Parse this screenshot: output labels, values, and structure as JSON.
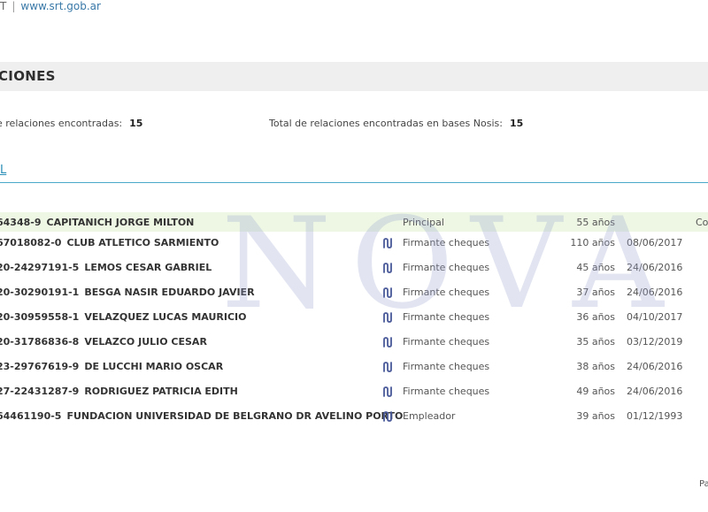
{
  "topbar": {
    "left_fragment": "T",
    "separator": "|",
    "link": "www.srt.gob.ar"
  },
  "section": {
    "title": "CIONES"
  },
  "summary": {
    "left_label": "e relaciones encontradas:",
    "left_value": "15",
    "right_label": "Total de relaciones encontradas en bases Nosis:",
    "right_value": "15"
  },
  "tab": {
    "label": "L"
  },
  "watermark": "NOVA",
  "rows": [
    {
      "id": "64348-9",
      "name": "CAPITANICH JORGE MILTON",
      "relation": "Principal",
      "age": "55 años",
      "date": "",
      "extra": "Co",
      "has_icon": false
    },
    {
      "id": "67018082-0",
      "name": "CLUB ATLETICO SARMIENTO",
      "relation": "Firmante cheques",
      "age": "110 años",
      "date": "08/06/2017",
      "extra": "",
      "has_icon": true
    },
    {
      "id": "20-24297191-5",
      "name": "LEMOS CESAR GABRIEL",
      "relation": "Firmante cheques",
      "age": "45 años",
      "date": "24/06/2016",
      "extra": "",
      "has_icon": true
    },
    {
      "id": "20-30290191-1",
      "name": "BESGA NASIR EDUARDO JAVIER",
      "relation": "Firmante cheques",
      "age": "37 años",
      "date": "24/06/2016",
      "extra": "",
      "has_icon": true
    },
    {
      "id": "20-30959558-1",
      "name": "VELAZQUEZ LUCAS MAURICIO",
      "relation": "Firmante cheques",
      "age": "36 años",
      "date": "04/10/2017",
      "extra": "",
      "has_icon": true
    },
    {
      "id": "20-31786836-8",
      "name": "VELAZCO JULIO CESAR",
      "relation": "Firmante cheques",
      "age": "35 años",
      "date": "03/12/2019",
      "extra": "",
      "has_icon": true
    },
    {
      "id": "23-29767619-9",
      "name": "DE LUCCHI MARIO OSCAR",
      "relation": "Firmante cheques",
      "age": "38 años",
      "date": "24/06/2016",
      "extra": "",
      "has_icon": true
    },
    {
      "id": "27-22431287-9",
      "name": "RODRIGUEZ PATRICIA EDITH",
      "relation": "Firmante cheques",
      "age": "49 años",
      "date": "24/06/2016",
      "extra": "",
      "has_icon": true
    },
    {
      "id": "64461190-5",
      "name": "FUNDACION UNIVERSIDAD DE BELGRANO DR AVELINO PORTO",
      "relation": "Empleador",
      "age": "39 años",
      "date": "01/12/1993",
      "extra": "",
      "has_icon": true
    }
  ],
  "footer": {
    "corner": "Pa"
  },
  "colors": {
    "accent": "#2a8fb8",
    "first_row_bg": "#eef7e4",
    "section_bg": "#efefef",
    "icon": "#4a5a9a"
  }
}
